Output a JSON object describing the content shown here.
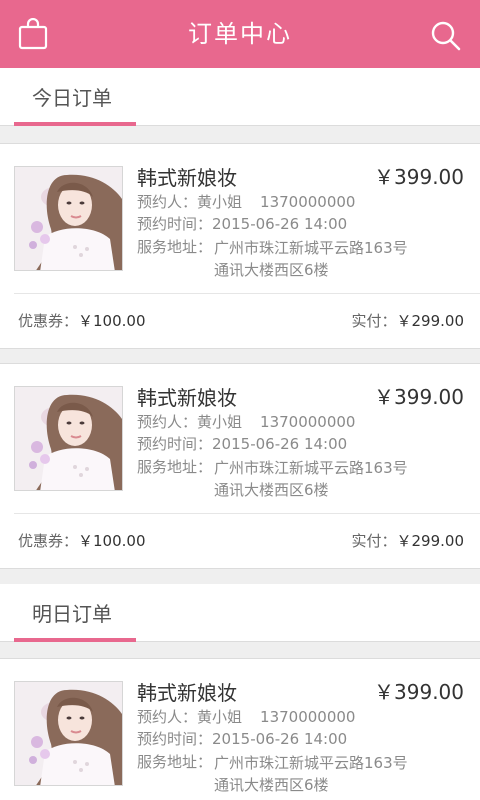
{
  "header": {
    "title": "订单中心",
    "left_icon": "shopping-bag-icon",
    "right_icon": "search-icon"
  },
  "sections": [
    {
      "title": "今日订单"
    },
    {
      "title": "明日订单"
    }
  ],
  "orders": [
    {
      "name": "韩式新娘妆",
      "price": "￥399.00",
      "booker_label": "预约人：",
      "booker": "黄小姐",
      "phone": "1370000000",
      "time_label": "预约时间：",
      "time": "2015-06-26 14:00",
      "addr_label": "服务地址：",
      "addr_line1": "广州市珠江新城平云路163号",
      "addr_line2": "通讯大楼西区6楼",
      "coupon_label": "优惠券：",
      "coupon": "￥100.00",
      "paid_label": "实付：",
      "paid": "￥299.00"
    },
    {
      "name": "韩式新娘妆",
      "price": "￥399.00",
      "booker_label": "预约人：",
      "booker": "黄小姐",
      "phone": "1370000000",
      "time_label": "预约时间：",
      "time": "2015-06-26 14:00",
      "addr_label": "服务地址：",
      "addr_line1": "广州市珠江新城平云路163号",
      "addr_line2": "通讯大楼西区6楼",
      "coupon_label": "优惠券：",
      "coupon": "￥100.00",
      "paid_label": "实付：",
      "paid": "￥299.00"
    },
    {
      "name": "韩式新娘妆",
      "price": "￥399.00",
      "booker_label": "预约人：",
      "booker": "黄小姐",
      "phone": "1370000000",
      "time_label": "预约时间：",
      "time": "2015-06-26 14:00",
      "addr_label": "服务地址：",
      "addr_line1": "广州市珠江新城平云路163号",
      "addr_line2": "通讯大楼西区6楼"
    }
  ],
  "colors": {
    "accent": "#e8688e",
    "background": "#efefef"
  }
}
